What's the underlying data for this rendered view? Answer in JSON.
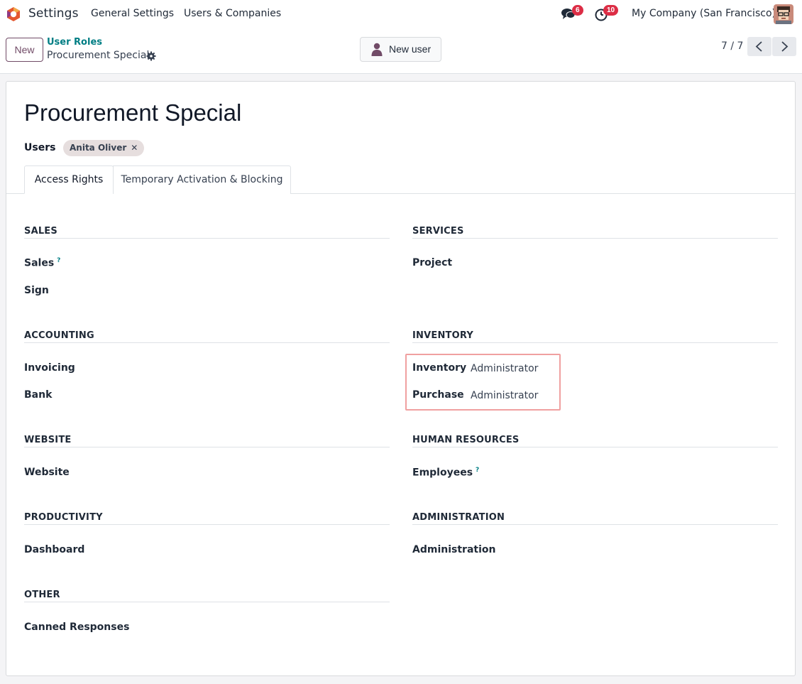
{
  "navbar": {
    "app_title": "Settings",
    "menus": [
      "General Settings",
      "Users & Companies"
    ],
    "messages_count": "6",
    "activities_count": "10",
    "company": "My Company (San Francisco)"
  },
  "control_panel": {
    "new_label": "New",
    "breadcrumb_parent": "User Roles",
    "breadcrumb_current": "Procurement Special",
    "new_user_label": "New user",
    "pager": "7 / 7"
  },
  "form": {
    "title": "Procurement Special",
    "users_label": "Users",
    "users": [
      "Anita Oliver"
    ],
    "tabs": [
      "Access Rights",
      "Temporary Activation & Blocking"
    ],
    "sections": {
      "sales": {
        "title": "SALES",
        "fields": [
          "Sales",
          "Sign"
        ]
      },
      "services": {
        "title": "SERVICES",
        "fields": [
          "Project"
        ]
      },
      "accounting": {
        "title": "ACCOUNTING",
        "fields": [
          "Invoicing",
          "Bank"
        ]
      },
      "inventory": {
        "title": "INVENTORY",
        "fields": [
          {
            "label": "Inventory",
            "value": "Administrator"
          },
          {
            "label": "Purchase",
            "value": "Administrator"
          }
        ]
      },
      "website": {
        "title": "WEBSITE",
        "fields": [
          "Website"
        ]
      },
      "human_resources": {
        "title": "HUMAN RESOURCES",
        "fields": [
          "Employees"
        ]
      },
      "productivity": {
        "title": "PRODUCTIVITY",
        "fields": [
          "Dashboard"
        ]
      },
      "administration": {
        "title": "ADMINISTRATION",
        "fields": [
          "Administration"
        ]
      },
      "other": {
        "title": "OTHER",
        "fields": [
          "Canned Responses"
        ]
      }
    },
    "help_mark": "?"
  },
  "colors": {
    "brand": "#714b67",
    "link": "#017e84",
    "badge": "#dc2d45",
    "highlight_border": "#f0a0a0"
  }
}
